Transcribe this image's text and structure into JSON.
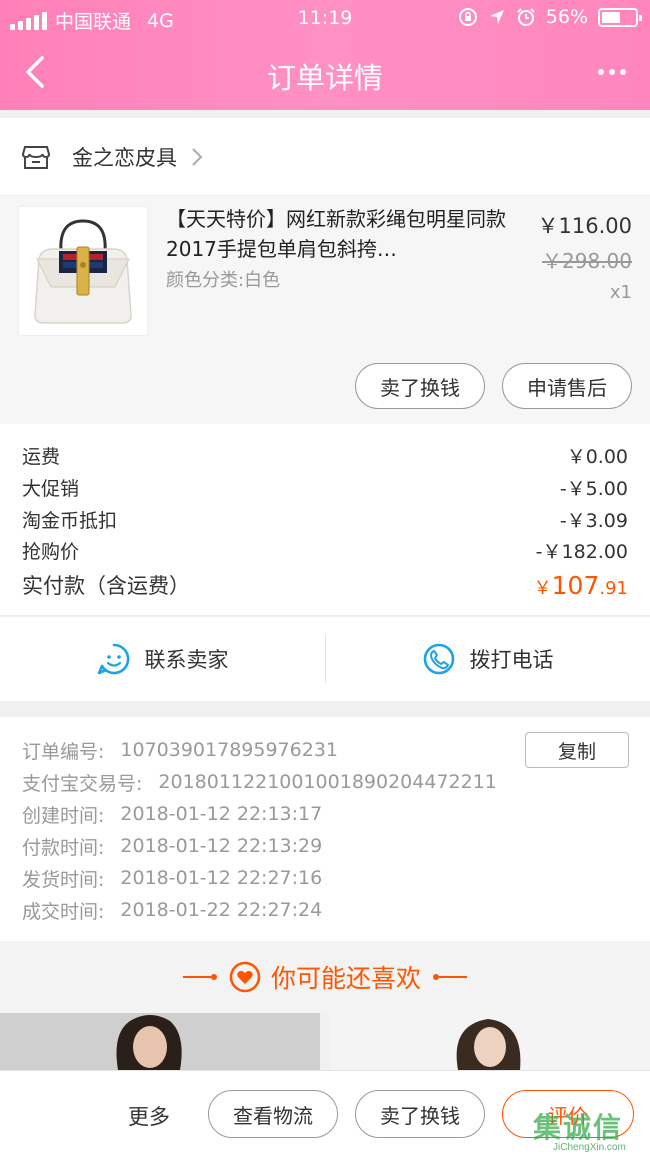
{
  "status_bar": {
    "carrier": "中国联通",
    "network": "4G",
    "time": "11:19",
    "battery": "56%",
    "battery_level": 0.56
  },
  "nav": {
    "title": "订单详情",
    "back_icon": "chevron-left-icon",
    "more_icon": "more-dots-icon"
  },
  "shop": {
    "icon": "store-icon",
    "name": "金之恋皮具"
  },
  "product": {
    "title": "【天天特价】网红新款彩绳包明星同款2017手提包单肩包斜挎…",
    "attribute": "颜色分类:白色",
    "price": "￥116.00",
    "original_price": "￥298.00",
    "quantity": "x1",
    "sell_button": "卖了换钱",
    "after_sale_button": "申请售后"
  },
  "costs": {
    "rows": [
      {
        "label": "运费",
        "value": "￥0.00"
      },
      {
        "label": "大促销",
        "value": "-￥5.00"
      },
      {
        "label": "淘金币抵扣",
        "value": "-￥3.09"
      },
      {
        "label": "抢购价",
        "value": "-￥182.00"
      }
    ],
    "total_label": "实付款（含运费）",
    "total_currency": "￥",
    "total_integer": "107",
    "total_decimal": ".91"
  },
  "contact": {
    "seller_label": "联系卖家",
    "phone_label": "拨打电话",
    "seller_icon": "chat-face-icon",
    "phone_icon": "phone-icon"
  },
  "order_info": {
    "copy_button": "复制",
    "rows": [
      {
        "label": "订单编号:",
        "value": "107039017895976231"
      },
      {
        "label": "支付宝交易号:",
        "value": "2018011221001001890204472211"
      },
      {
        "label": "创建时间:",
        "value": "2018-01-12 22:13:17"
      },
      {
        "label": "付款时间:",
        "value": "2018-01-12 22:13:29"
      },
      {
        "label": "发货时间:",
        "value": "2018-01-12 22:27:16"
      },
      {
        "label": "成交时间:",
        "value": "2018-01-22 22:27:24"
      }
    ]
  },
  "recommend": {
    "title": "你可能还喜欢",
    "icon": "heart-icon"
  },
  "bottom_bar": {
    "more": "更多",
    "logistics": "查看物流",
    "sell": "卖了换钱",
    "review": "评价"
  },
  "colors": {
    "header_pink": "#ff88bf",
    "accent_orange": "#ff5500",
    "icon_blue": "#1ea3e8"
  },
  "watermark": {
    "main": "集诚信",
    "sub": "JiChengXin.com"
  }
}
